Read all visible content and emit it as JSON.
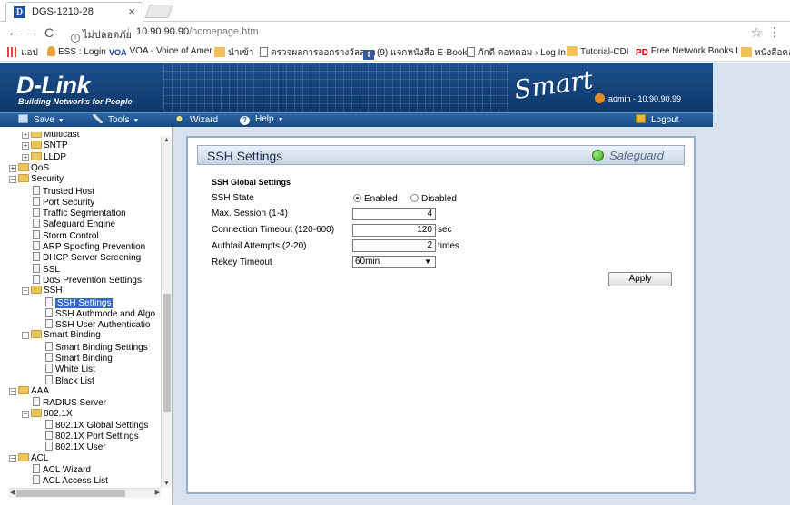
{
  "browser": {
    "tab_title": "DGS-1210-28",
    "tab_close": "×",
    "security_label": "ไม่ปลอดภัย",
    "url_host": "10.90.90.90",
    "url_path": "/homepage.htm",
    "back": "←",
    "forward": "→",
    "reload": "C",
    "star": "☆",
    "menu": "⋮"
  },
  "bookmarks": [
    {
      "label": "แอป",
      "icon": "apps-icon"
    },
    {
      "label": "ESS : Login",
      "icon": "person-icon"
    },
    {
      "label": "VOA - Voice of Amer",
      "icon": "voa-icon",
      "prefix": "VOA"
    },
    {
      "label": "นำเข้า",
      "icon": "folder-icon"
    },
    {
      "label": "ตรวจผลการออกรางวัลสลา",
      "icon": "doc-icon"
    },
    {
      "label": "(9) แจกหนังสือ E-Book",
      "icon": "facebook-icon",
      "prefix": "f"
    },
    {
      "label": "ภักดี ดอทคอม › Log In",
      "icon": "doc-icon"
    },
    {
      "label": "Tutorial-CDI",
      "icon": "folder-icon"
    },
    {
      "label": "Free Network Books I",
      "icon": "pd-icon",
      "prefix": "PD"
    },
    {
      "label": "หนังสือคอ",
      "icon": "folder-icon"
    }
  ],
  "header": {
    "logo": "D-Link",
    "tagline": "Building Networks for People",
    "smart": "Smart",
    "user": "admin - 10.90.90.99"
  },
  "menu": {
    "save": "Save",
    "tools": "Tools",
    "wizard": "Wizard",
    "help": "Help",
    "logout": "Logout",
    "caret": "▼"
  },
  "tree": [
    {
      "label": "Multicast",
      "indent": 2,
      "type": "folder",
      "exp": "+"
    },
    {
      "label": "SNTP",
      "indent": 2,
      "type": "folder",
      "exp": "+"
    },
    {
      "label": "LLDP",
      "indent": 2,
      "type": "folder",
      "exp": "+"
    },
    {
      "label": "QoS",
      "indent": 1,
      "type": "folder",
      "exp": "+"
    },
    {
      "label": "Security",
      "indent": 1,
      "type": "folder",
      "exp": "−"
    },
    {
      "label": "Trusted Host",
      "indent": 2,
      "type": "doc"
    },
    {
      "label": "Port Security",
      "indent": 2,
      "type": "doc"
    },
    {
      "label": "Traffic Segmentation",
      "indent": 2,
      "type": "doc"
    },
    {
      "label": "Safeguard Engine",
      "indent": 2,
      "type": "doc"
    },
    {
      "label": "Storm Control",
      "indent": 2,
      "type": "doc"
    },
    {
      "label": "ARP Spoofing Prevention",
      "indent": 2,
      "type": "doc"
    },
    {
      "label": "DHCP Server Screening",
      "indent": 2,
      "type": "doc"
    },
    {
      "label": "SSL",
      "indent": 2,
      "type": "doc"
    },
    {
      "label": "DoS Prevention Settings",
      "indent": 2,
      "type": "doc"
    },
    {
      "label": "SSH",
      "indent": 2,
      "type": "folder",
      "exp": "−"
    },
    {
      "label": "SSH Settings",
      "indent": 3,
      "type": "doc",
      "selected": true
    },
    {
      "label": "SSH Authmode and Algo",
      "indent": 3,
      "type": "doc"
    },
    {
      "label": "SSH User Authenticatio",
      "indent": 3,
      "type": "doc"
    },
    {
      "label": "Smart Binding",
      "indent": 2,
      "type": "folder",
      "exp": "−"
    },
    {
      "label": "Smart Binding Settings",
      "indent": 3,
      "type": "doc"
    },
    {
      "label": "Smart Binding",
      "indent": 3,
      "type": "doc"
    },
    {
      "label": "White List",
      "indent": 3,
      "type": "doc"
    },
    {
      "label": "Black List",
      "indent": 3,
      "type": "doc"
    },
    {
      "label": "AAA",
      "indent": 1,
      "type": "folder",
      "exp": "−"
    },
    {
      "label": "RADIUS Server",
      "indent": 2,
      "type": "doc"
    },
    {
      "label": "802.1X",
      "indent": 2,
      "type": "folder",
      "exp": "−"
    },
    {
      "label": "802.1X Global Settings",
      "indent": 3,
      "type": "doc"
    },
    {
      "label": "802.1X Port Settings",
      "indent": 3,
      "type": "doc"
    },
    {
      "label": "802.1X User",
      "indent": 3,
      "type": "doc"
    },
    {
      "label": "ACL",
      "indent": 1,
      "type": "folder",
      "exp": "−"
    },
    {
      "label": "ACL Wizard",
      "indent": 2,
      "type": "doc"
    },
    {
      "label": "ACL Access List",
      "indent": 2,
      "type": "doc"
    }
  ],
  "ssh": {
    "title": "SSH Settings",
    "safeguard": "Safeguard",
    "legend": "SSH Global Settings",
    "state_label": "SSH State",
    "enabled_label": "Enabled",
    "disabled_label": "Disabled",
    "state_value": "Enabled",
    "max_session_label": "Max. Session (1-4)",
    "max_session_value": "4",
    "conn_timeout_label": "Connection Timeout (120-600)",
    "conn_timeout_value": "120",
    "conn_timeout_unit": "sec",
    "authfail_label": "Authfail Attempts (2-20)",
    "authfail_value": "2",
    "authfail_unit": "times",
    "rekey_label": "Rekey Timeout",
    "rekey_value": "60min",
    "apply_label": "Apply"
  }
}
